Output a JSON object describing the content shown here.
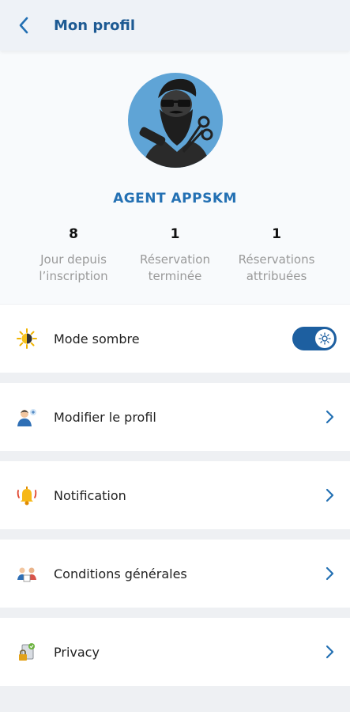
{
  "header": {
    "title": "Mon profil",
    "back_icon": "chevron-left-icon",
    "accent_color": "#1d5a93"
  },
  "profile": {
    "name": "AGENT APPSKM",
    "avatar_icon": "barber-avatar-icon",
    "stats": [
      {
        "value": "8",
        "label_line1": "Jour depuis",
        "label_line2": "l’inscription"
      },
      {
        "value": "1",
        "label_line1": "Réservation",
        "label_line2": "terminée"
      },
      {
        "value": "1",
        "label_line1": "Réservations",
        "label_line2": "attribuées"
      }
    ]
  },
  "settings": {
    "dark_mode": {
      "label": "Mode sombre",
      "icon": "sun-half-icon",
      "enabled": true,
      "toggle_color": "#1d5fa0"
    },
    "items": [
      {
        "label": "Modifier le profil",
        "icon": "edit-profile-icon"
      },
      {
        "label": "Notification",
        "icon": "bell-icon"
      },
      {
        "label": "Conditions générales",
        "icon": "terms-people-icon"
      },
      {
        "label": "Privacy",
        "icon": "privacy-lock-icon"
      }
    ]
  }
}
